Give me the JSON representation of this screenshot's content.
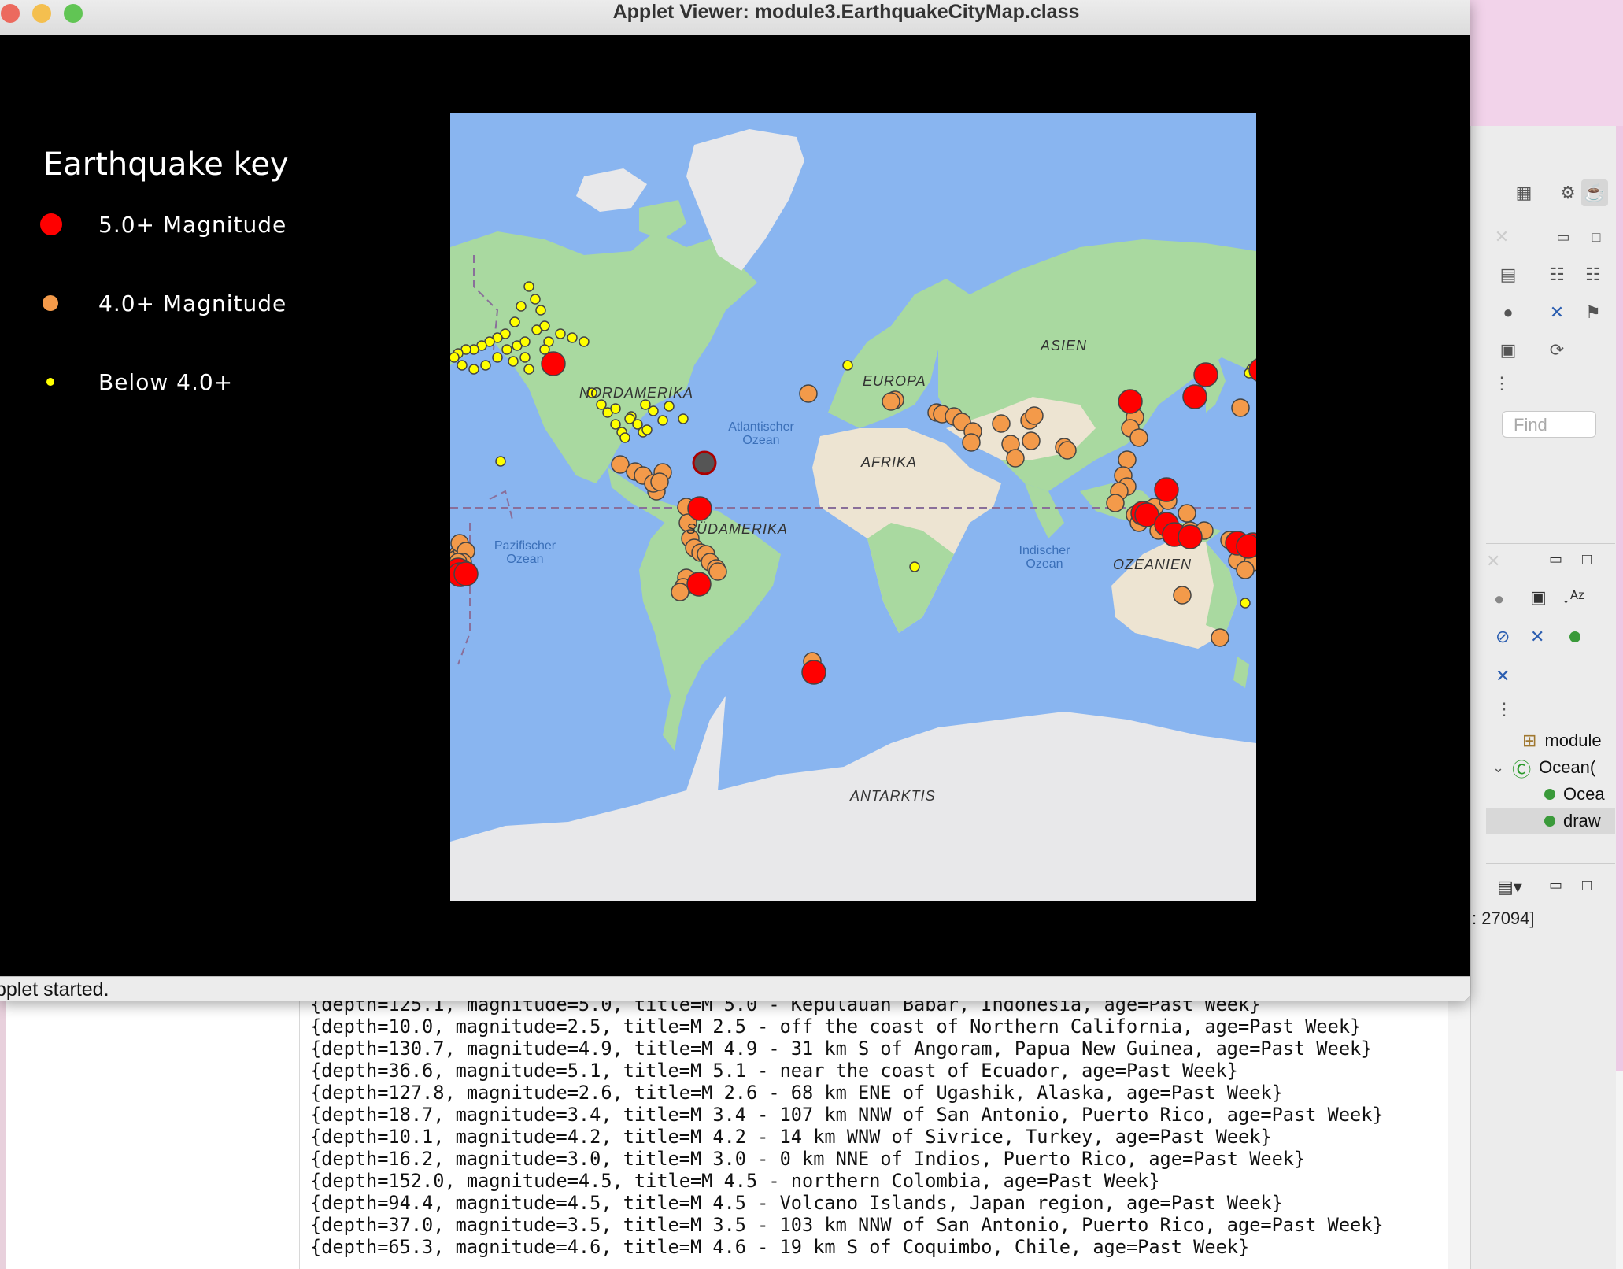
{
  "window": {
    "title": "Applet Viewer: module3.EarthquakeCityMap.class",
    "status": "pplet started."
  },
  "legend": {
    "title": "Earthquake key",
    "items": [
      {
        "label": "5.0+ Magnitude",
        "color": "#ff0000"
      },
      {
        "label": "4.0+ Magnitude",
        "color": "#f39a4a"
      },
      {
        "label": "Below 4.0+",
        "color": "#ffff00"
      }
    ]
  },
  "map": {
    "labels": {
      "north_america": "NORDAMERIKA",
      "europe": "EUROPA",
      "asia": "ASIEN",
      "africa": "AFRIKA",
      "south_america": "SÜDAMERIKA",
      "oceania": "OZEANIEN",
      "antarctica": "ANTARKTIS",
      "atlantic": "Atlantischer Ozean",
      "pacific": "Pazifischer Ozean",
      "indian": "Indischer Ozean"
    },
    "colors": {
      "ocean": "#89b5f0",
      "land": "#a9d9a0",
      "ice": "#e8e8ea",
      "desert": "#ede4d2"
    }
  },
  "eclipse": {
    "find_placeholder": "Find",
    "port_text": ": 27094]",
    "tree": [
      {
        "label": "module",
        "icon": "package-icon"
      },
      {
        "label": "Ocean(",
        "icon": "class-icon"
      },
      {
        "label": "Ocea",
        "icon": "constructor-icon"
      },
      {
        "label": "draw",
        "icon": "method-icon"
      }
    ]
  },
  "console": {
    "lines": [
      "{depth=125.1, magnitude=5.0, title=M 5.0 - Kepulauan Babar, Indonesia, age=Past Week}",
      "{depth=10.0, magnitude=2.5, title=M 2.5 - off the coast of Northern California, age=Past Week}",
      "{depth=130.7, magnitude=4.9, title=M 4.9 - 31 km S of Angoram, Papua New Guinea, age=Past Week}",
      "{depth=36.6, magnitude=5.1, title=M 5.1 - near the coast of Ecuador, age=Past Week}",
      "{depth=127.8, magnitude=2.6, title=M 2.6 - 68 km ENE of Ugashik, Alaska, age=Past Week}",
      "{depth=18.7, magnitude=3.4, title=M 3.4 - 107 km NNW of San Antonio, Puerto Rico, age=Past Week}",
      "{depth=10.1, magnitude=4.2, title=M 4.2 - 14 km WNW of Sivrice, Turkey, age=Past Week}",
      "{depth=16.2, magnitude=3.0, title=M 3.0 - 0 km NNE of Indios, Puerto Rico, age=Past Week}",
      "{depth=152.0, magnitude=4.5, title=M 4.5 - northern Colombia, age=Past Week}",
      "{depth=94.4, magnitude=4.5, title=M 4.5 - Volcano Islands, Japan region, age=Past Week}",
      "{depth=37.0, magnitude=3.5, title=M 3.5 - 103 km NNW of San Antonio, Puerto Rico, age=Past Week}",
      "{depth=65.3, magnitude=4.6, title=M 4.6 - 19 km S of Coquimbo, Chile, age=Past Week}"
    ]
  }
}
